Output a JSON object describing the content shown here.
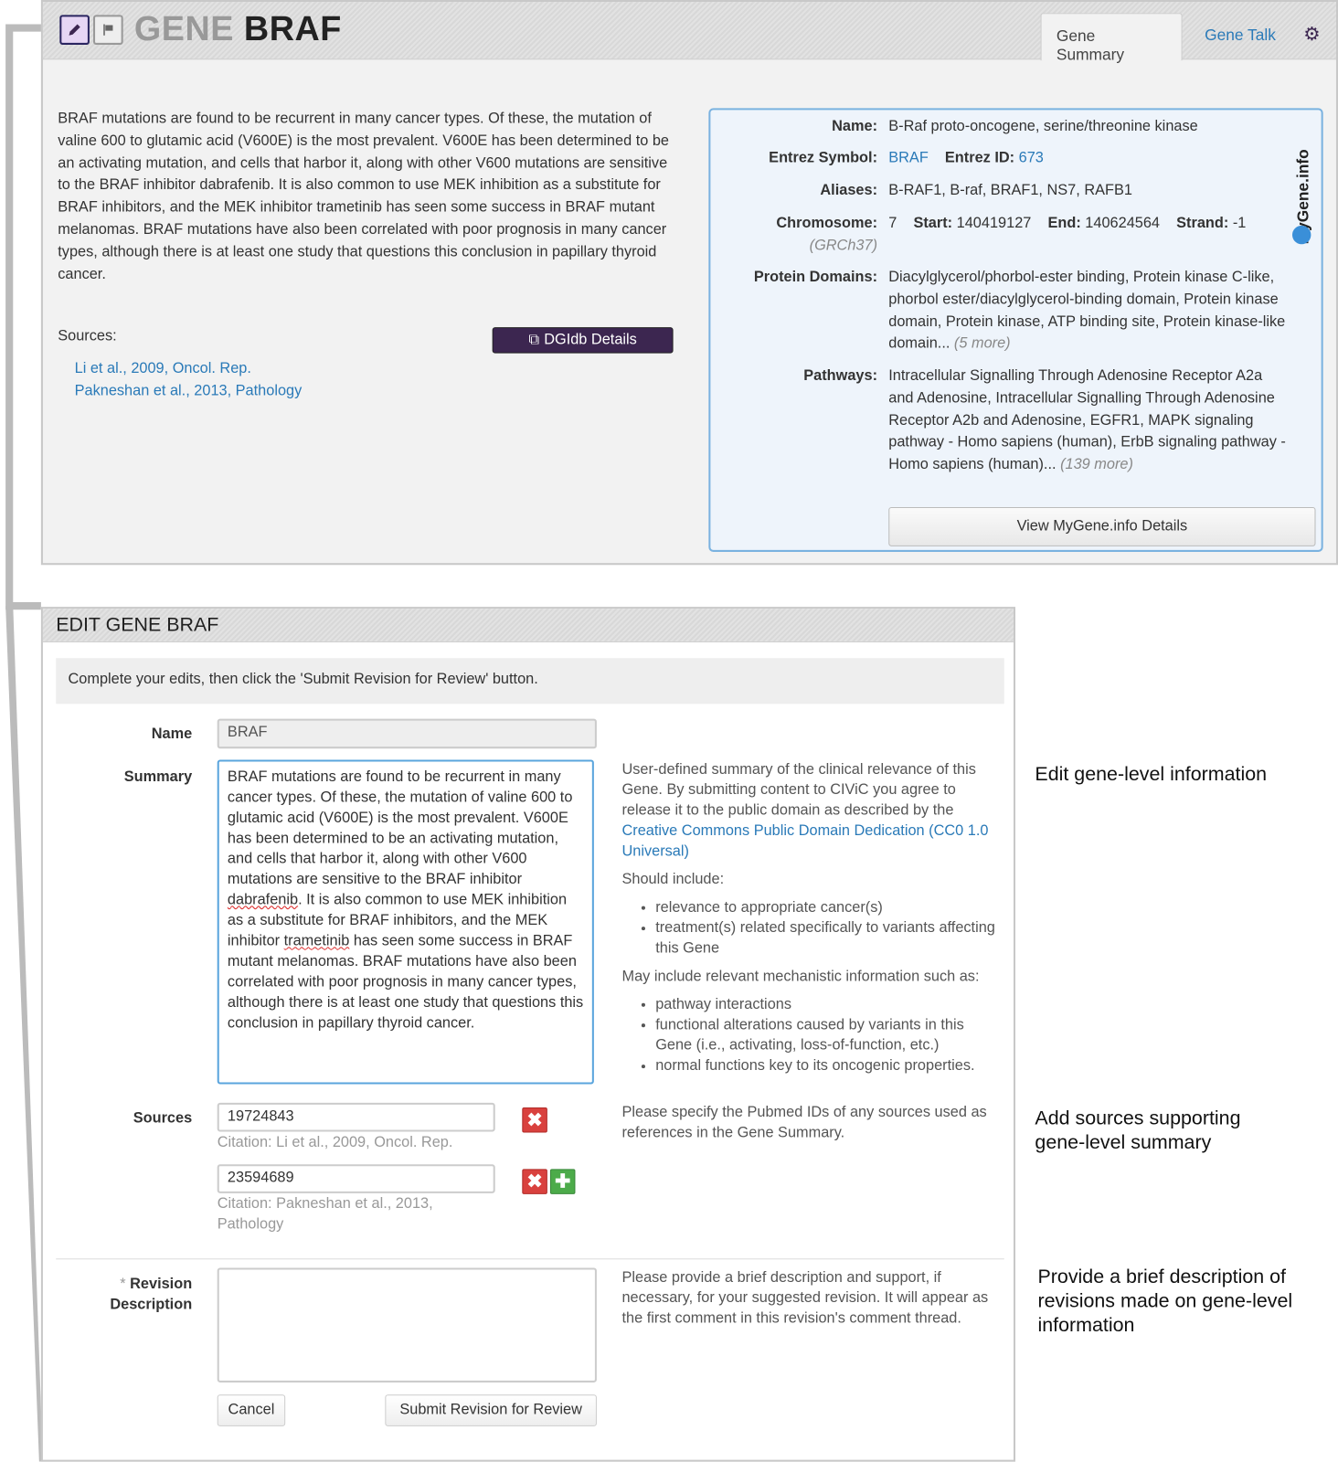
{
  "header": {
    "title_prefix": "GENE",
    "title_gene": "BRAF",
    "tabs": [
      {
        "label": "Gene Summary",
        "active": true
      },
      {
        "label": "Gene Talk",
        "active": false
      }
    ]
  },
  "summary": {
    "text": "BRAF mutations are found to be recurrent in many cancer types. Of these, the mutation of valine 600 to glutamic acid (V600E) is the most prevalent. V600E has been determined to be an activating mutation, and cells that harbor it, along with other V600 mutations are sensitive to the BRAF inhibitor dabrafenib. It is also common to use MEK inhibition as a substitute for BRAF inhibitors, and the MEK inhibitor trametinib has seen some success in BRAF mutant melanomas. BRAF mutations have also been correlated with poor prognosis in many cancer types, although there is at least one study that questions this conclusion in papillary thyroid cancer.",
    "sources_label": "Sources:",
    "sources": [
      "Li et al., 2009, Oncol. Rep.",
      "Pakneshan et al., 2013, Pathology"
    ],
    "dgidb_label": "DGIdb Details"
  },
  "mygene": {
    "brand": "MyGene.info",
    "name_label": "Name:",
    "name": "B-Raf proto-oncogene, serine/threonine kinase",
    "entrez_symbol_label": "Entrez Symbol:",
    "entrez_symbol": "BRAF",
    "entrez_id_label": "Entrez ID:",
    "entrez_id": "673",
    "aliases_label": "Aliases:",
    "aliases": "B-RAF1, B-raf, BRAF1, NS7, RAFB1",
    "chromosome_label": "Chromosome:",
    "assembly": "(GRCh37)",
    "chromosome": "7",
    "start_label": "Start:",
    "start": "140419127",
    "end_label": "End:",
    "end": "140624564",
    "strand_label": "Strand:",
    "strand": "-1",
    "domains_label": "Protein Domains:",
    "domains": "Diacylglycerol/phorbol-ester binding, Protein kinase C-like, phorbol ester/diacylglycerol-binding domain, Protein kinase domain, Protein kinase, ATP binding site, Protein kinase-like domain...",
    "domains_more": "(5 more)",
    "pathways_label": "Pathways:",
    "pathways": "Intracellular Signalling Through Adenosine Receptor A2a and Adenosine, Intracellular Signalling Through Adenosine Receptor A2b and Adenosine, EGFR1, MAPK signaling pathway - Homo sapiens (human), ErbB signaling pathway - Homo sapiens (human)...",
    "pathways_more": "(139 more)",
    "details_button": "View MyGene.info Details"
  },
  "edit": {
    "title": "EDIT GENE BRAF",
    "instructions": "Complete your edits, then click the 'Submit Revision for Review' button.",
    "name_label": "Name",
    "name_value": "BRAF",
    "summary_label": "Summary",
    "summary_help": "User-defined summary of the clinical relevance of this Gene. By submitting content to CIViC you agree to release it to the public domain as described by the",
    "summary_help_link": "Creative Commons Public Domain Dedication (CC0 1.0 Universal)",
    "should_include": "Should include:",
    "should_items": [
      "relevance to appropriate cancer(s)",
      "treatment(s) related specifically to variants affecting this Gene"
    ],
    "may_include": "May include relevant mechanistic information such as:",
    "may_items": [
      "pathway interactions",
      "functional alterations caused by variants in this Gene (i.e., activating, loss-of-function, etc.)",
      "normal functions key to its oncogenic properties."
    ],
    "sources_label": "Sources",
    "sources": [
      {
        "pmid": "19724843",
        "citation": "Citation: Li et al., 2009, Oncol. Rep."
      },
      {
        "pmid": "23594689",
        "citation": "Citation: Pakneshan et al., 2013, Pathology"
      }
    ],
    "sources_help": "Please specify the Pubmed IDs of any sources used as references in the Gene Summary.",
    "revision_label_1": "Revision",
    "revision_label_2": "Description",
    "required_mark": "*",
    "revision_value": "",
    "revision_help": "Please provide a brief description and support, if necessary, for your suggested revision. It will appear as the first comment in this revision's comment thread.",
    "cancel_label": "Cancel",
    "submit_label": "Submit Revision for Review"
  },
  "annotations": [
    "Edit gene-level information",
    "Add sources supporting gene-level summary",
    "Provide a brief description of revisions made on gene-level information"
  ],
  "colors": {
    "accent": "#3c2650",
    "link": "#2a7ab8",
    "panel_border": "#7ab2e0",
    "remove": "#d9413e",
    "add": "#4cab4a"
  }
}
